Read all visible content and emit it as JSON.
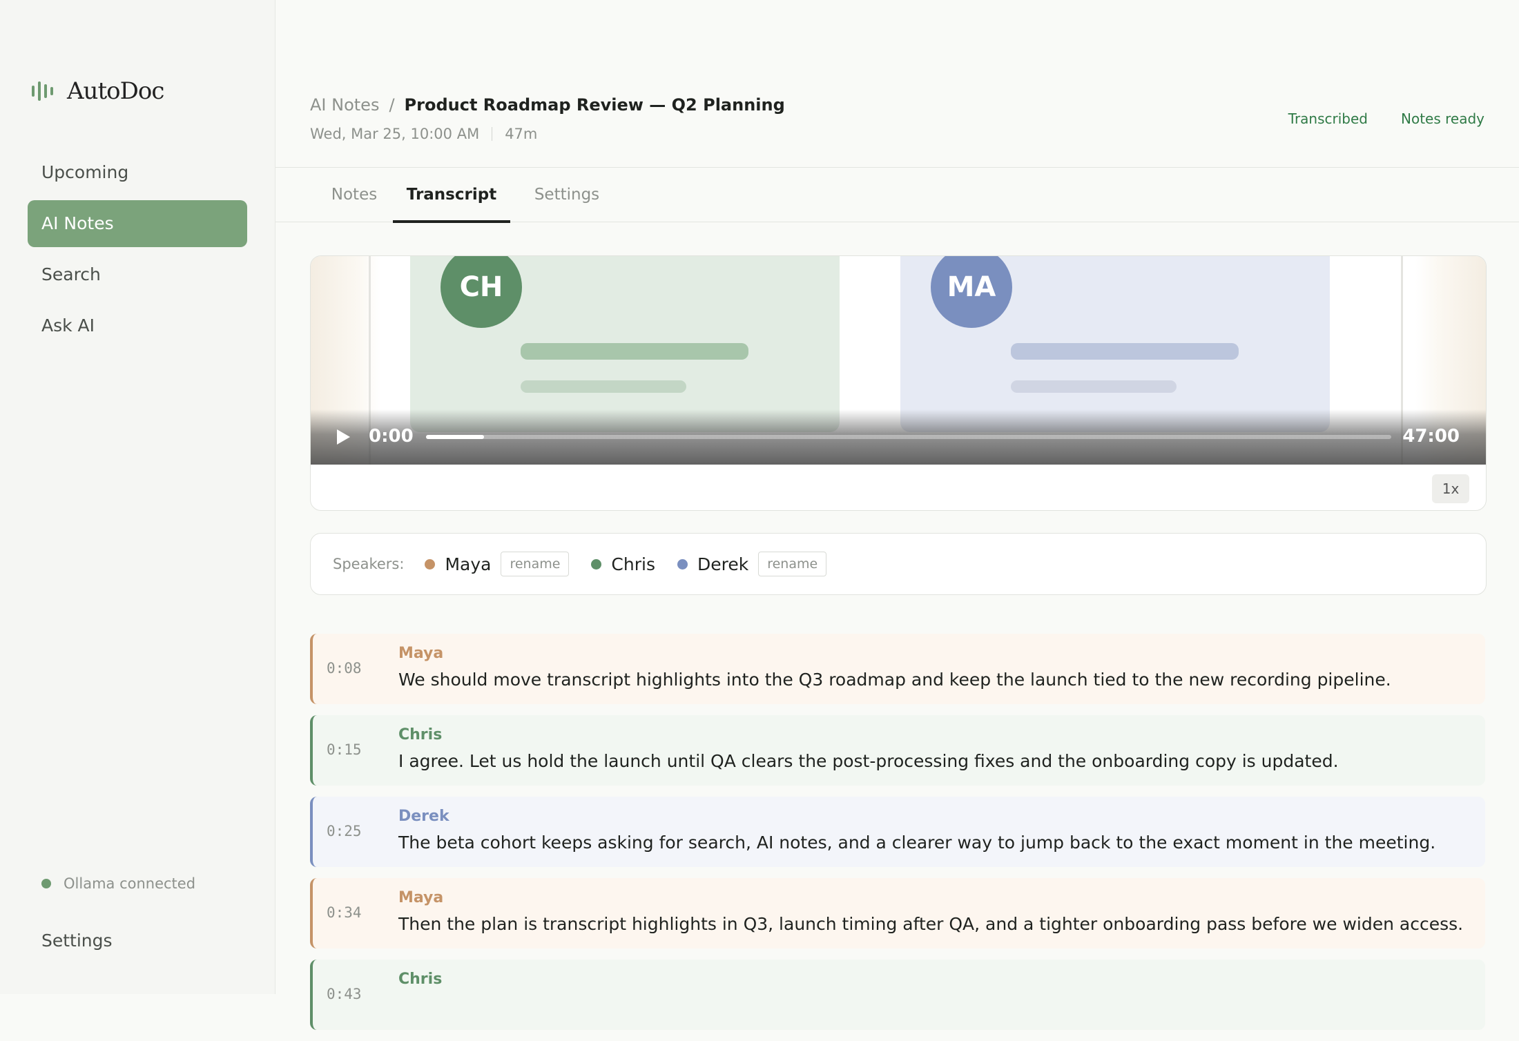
{
  "app": {
    "name": "AutoDoc"
  },
  "sidebar": {
    "items": [
      {
        "label": "Upcoming",
        "active": false
      },
      {
        "label": "AI Notes",
        "active": true
      },
      {
        "label": "Search",
        "active": false
      },
      {
        "label": "Ask AI",
        "active": false
      }
    ],
    "status": "Ollama connected",
    "settings": "Settings"
  },
  "header": {
    "breadcrumb_parent": "AI Notes",
    "breadcrumb_sep": "/",
    "title": "Product Roadmap Review — Q2 Planning",
    "date": "Wed, Mar 25, 10:00 AM",
    "duration": "47m",
    "badges": [
      "Transcribed",
      "Notes ready"
    ]
  },
  "tabs": [
    {
      "label": "Notes",
      "active": false
    },
    {
      "label": "Transcript",
      "active": true
    },
    {
      "label": "Settings",
      "active": false
    }
  ],
  "player": {
    "participants": [
      "CH",
      "MA"
    ],
    "current_time": "0:00",
    "total_time": "47:00",
    "progress": 0.06,
    "speed": "1x"
  },
  "speakers": {
    "label": "Speakers:",
    "list": [
      {
        "name": "Maya",
        "color": "#c59367",
        "rename": "rename"
      },
      {
        "name": "Chris",
        "color": "#5e8f68",
        "rename": ""
      },
      {
        "name": "Derek",
        "color": "#7a8fbf",
        "rename": "rename"
      }
    ]
  },
  "segments": [
    {
      "time": "0:08",
      "speaker": "Maya",
      "text": "We should move transcript highlights into the Q3 roadmap and keep the launch tied to the new recording pipeline."
    },
    {
      "time": "0:15",
      "speaker": "Chris",
      "text": "I agree. Let us hold the launch until QA clears the post-processing fixes and the onboarding copy is updated."
    },
    {
      "time": "0:25",
      "speaker": "Derek",
      "text": "The beta cohort keeps asking for search, AI notes, and a clearer way to jump back to the exact moment in the meeting."
    },
    {
      "time": "0:34",
      "speaker": "Maya",
      "text": "Then the plan is transcript highlights in Q3, launch timing after QA, and a tighter onboarding pass before we widen access."
    },
    {
      "time": "0:43",
      "speaker": "Chris",
      "text": ""
    }
  ],
  "colors": {
    "accent": "#7ba37b",
    "badge": "#2f7a46",
    "maya": "#c59367",
    "chris": "#5e8f68",
    "derek": "#7a8fbf",
    "maya_bg": "#fdf6ef",
    "chris_bg": "#f2f7f2",
    "derek_bg": "#f3f5fa"
  },
  "icons": {
    "brand": "waveform-icon",
    "play": "play-icon",
    "status": "status-dot-icon"
  }
}
